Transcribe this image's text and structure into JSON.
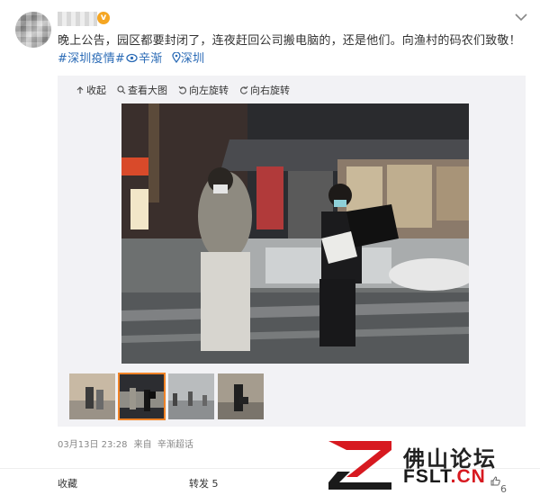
{
  "post": {
    "verified_badge": "v",
    "text_plain": "晚上公告，园区都要封闭了，连夜赶回公司搬电脑的，还是他们。向渔村的码农们致敬！",
    "hashtag": "#深圳疫情#",
    "mention": "辛渐",
    "location": "深圳"
  },
  "gallery": {
    "tools": [
      "收起",
      "查看大图",
      "向左旋转",
      "向右旋转"
    ],
    "thumbnail_count": 4,
    "selected_index": 1
  },
  "meta": {
    "date": "03月13日 23:28",
    "source_prefix": "来自",
    "source": "辛渐超话"
  },
  "actions": {
    "favorite": "收藏",
    "repost": "转发 5",
    "like": "6"
  },
  "watermark": {
    "cn": "佛山论坛",
    "en_prefix": "FSLT",
    "en_suffix": ".CN"
  },
  "colors": {
    "link": "#2b6bb6",
    "thumb_selected": "#f08327",
    "watermark_red": "#d71920"
  }
}
